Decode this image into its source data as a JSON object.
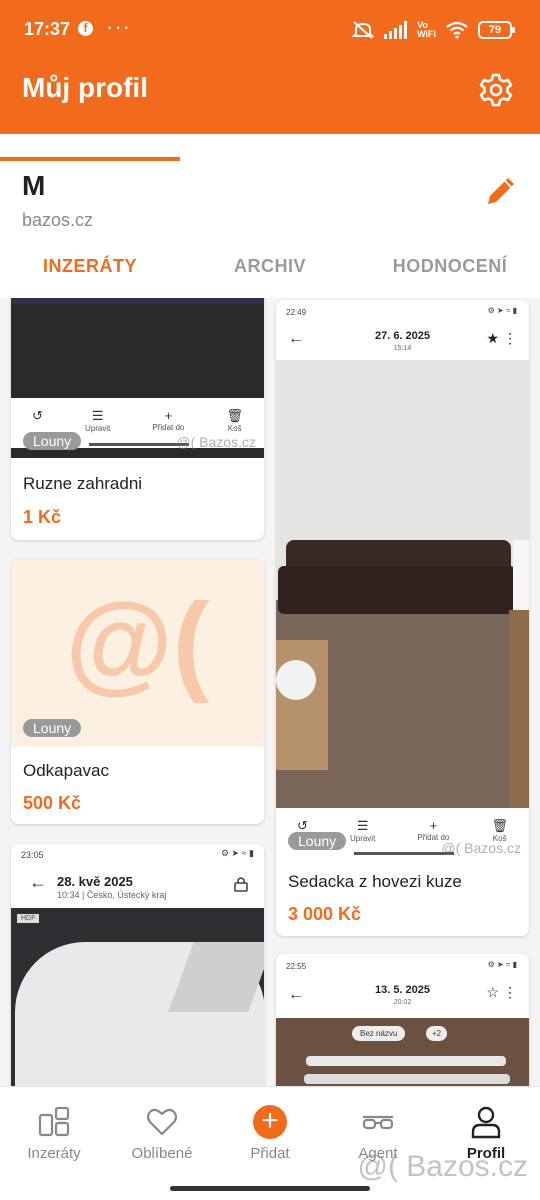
{
  "status_bar": {
    "time": "17:37",
    "dots": "···",
    "battery": "79",
    "vowifi_1": "Vo",
    "vowifi_2": "WiFi"
  },
  "header": {
    "title": "Můj profil"
  },
  "profile": {
    "name": "M",
    "site": "bazos.cz"
  },
  "tabs": [
    {
      "label": "INZERÁTY",
      "active": true
    },
    {
      "label": "ARCHIV",
      "active": false
    },
    {
      "label": "HODNOCENÍ",
      "active": false
    }
  ],
  "listings": [
    {
      "location": "Louny",
      "title": "Ruzne zahradni",
      "price": "1 Kč"
    },
    {
      "location": "Louny",
      "title": "Odkapavac",
      "price": "500 Kč",
      "placeholder": "@("
    },
    {
      "location": "Louny",
      "title": "Sedacka z hovezi kuze",
      "price": "3 000 Kč"
    }
  ],
  "shot_actions": [
    "Upravit",
    "Přidat do",
    "Koš"
  ],
  "shot_watermark": "@( Bazos.cz",
  "shot_sofa": {
    "time": "22:49",
    "date": "27. 6. 2025",
    "sub": "15:14"
  },
  "shot_sink": {
    "time": "23:05",
    "date": "28. kvě 2025",
    "sub": "10:34 | Česko, Ústecký kraj",
    "tag": "HDF"
  },
  "shot_last": {
    "time": "22:55",
    "date": "13. 5. 2025",
    "sub": "20:02",
    "chip": "Bez názvu",
    "chip2": "+2"
  },
  "bottom_nav": [
    {
      "label": "Inzeráty",
      "icon": "grid-icon"
    },
    {
      "label": "Oblíbené",
      "icon": "heart-icon"
    },
    {
      "label": "Přidat",
      "icon": "plus-icon"
    },
    {
      "label": "Agent",
      "icon": "glasses-icon"
    },
    {
      "label": "Profil",
      "icon": "person-icon",
      "active": true
    }
  ],
  "watermark": "@( Bazos.cz",
  "colors": {
    "accent": "#f26b1d"
  }
}
